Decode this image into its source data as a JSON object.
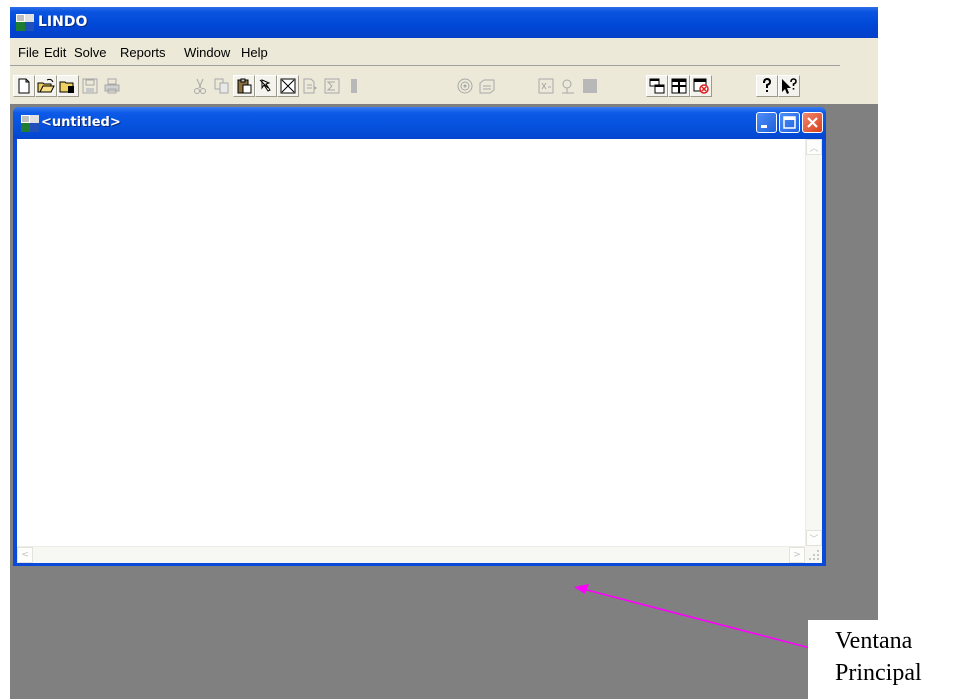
{
  "app": {
    "title": "LINDO",
    "menu": [
      "File",
      "Edit",
      "Solve",
      "Reports",
      "Window",
      "Help"
    ],
    "toolbar": [
      {
        "icon": "new-icon",
        "enabled": true
      },
      {
        "icon": "open-icon",
        "enabled": true
      },
      {
        "icon": "view-icon",
        "enabled": true
      },
      {
        "icon": "save-icon",
        "enabled": false
      },
      {
        "icon": "print-icon",
        "enabled": false
      },
      {
        "icon": "cut-icon",
        "enabled": false
      },
      {
        "icon": "copy-icon",
        "enabled": false
      },
      {
        "icon": "paste-icon",
        "enabled": true
      },
      {
        "icon": "find-icon",
        "enabled": true
      },
      {
        "icon": "clear-icon",
        "enabled": true
      },
      {
        "icon": "go-to-line-icon",
        "enabled": false
      },
      {
        "icon": "sigma-icon",
        "enabled": false
      },
      {
        "icon": "compile-icon",
        "enabled": false
      },
      {
        "icon": "solve-icon",
        "enabled": false
      },
      {
        "icon": "options-icon",
        "enabled": false
      },
      {
        "icon": "solution-icon",
        "enabled": false
      },
      {
        "icon": "picture-icon",
        "enabled": false
      },
      {
        "icon": "stop-icon",
        "enabled": false
      },
      {
        "icon": "cascade-icon",
        "enabled": true
      },
      {
        "icon": "tile-icon",
        "enabled": true
      },
      {
        "icon": "close-all-icon",
        "enabled": true
      },
      {
        "icon": "help-icon",
        "enabled": true
      },
      {
        "icon": "context-help-icon",
        "enabled": true
      }
    ]
  },
  "child_window": {
    "title": "<untitled>",
    "content": ""
  },
  "annotation": {
    "line1": "Ventana",
    "line2": "Principal",
    "arrow_color": "#ff00ff"
  },
  "colors": {
    "titlebar": "#0a55e0",
    "menu_bg": "#ece9d8",
    "mdi_bg": "#808080",
    "close_button": "#d8401a"
  }
}
